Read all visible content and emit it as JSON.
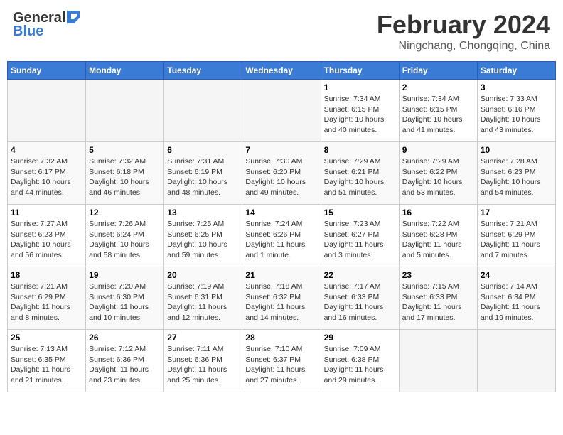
{
  "header": {
    "logo_general": "General",
    "logo_blue": "Blue",
    "title": "February 2024",
    "subtitle": "Ningchang, Chongqing, China"
  },
  "days_of_week": [
    "Sunday",
    "Monday",
    "Tuesday",
    "Wednesday",
    "Thursday",
    "Friday",
    "Saturday"
  ],
  "weeks": [
    [
      {
        "day": "",
        "info": ""
      },
      {
        "day": "",
        "info": ""
      },
      {
        "day": "",
        "info": ""
      },
      {
        "day": "",
        "info": ""
      },
      {
        "day": "1",
        "info": "Sunrise: 7:34 AM\nSunset: 6:15 PM\nDaylight: 10 hours\nand 40 minutes."
      },
      {
        "day": "2",
        "info": "Sunrise: 7:34 AM\nSunset: 6:15 PM\nDaylight: 10 hours\nand 41 minutes."
      },
      {
        "day": "3",
        "info": "Sunrise: 7:33 AM\nSunset: 6:16 PM\nDaylight: 10 hours\nand 43 minutes."
      }
    ],
    [
      {
        "day": "4",
        "info": "Sunrise: 7:32 AM\nSunset: 6:17 PM\nDaylight: 10 hours\nand 44 minutes."
      },
      {
        "day": "5",
        "info": "Sunrise: 7:32 AM\nSunset: 6:18 PM\nDaylight: 10 hours\nand 46 minutes."
      },
      {
        "day": "6",
        "info": "Sunrise: 7:31 AM\nSunset: 6:19 PM\nDaylight: 10 hours\nand 48 minutes."
      },
      {
        "day": "7",
        "info": "Sunrise: 7:30 AM\nSunset: 6:20 PM\nDaylight: 10 hours\nand 49 minutes."
      },
      {
        "day": "8",
        "info": "Sunrise: 7:29 AM\nSunset: 6:21 PM\nDaylight: 10 hours\nand 51 minutes."
      },
      {
        "day": "9",
        "info": "Sunrise: 7:29 AM\nSunset: 6:22 PM\nDaylight: 10 hours\nand 53 minutes."
      },
      {
        "day": "10",
        "info": "Sunrise: 7:28 AM\nSunset: 6:23 PM\nDaylight: 10 hours\nand 54 minutes."
      }
    ],
    [
      {
        "day": "11",
        "info": "Sunrise: 7:27 AM\nSunset: 6:23 PM\nDaylight: 10 hours\nand 56 minutes."
      },
      {
        "day": "12",
        "info": "Sunrise: 7:26 AM\nSunset: 6:24 PM\nDaylight: 10 hours\nand 58 minutes."
      },
      {
        "day": "13",
        "info": "Sunrise: 7:25 AM\nSunset: 6:25 PM\nDaylight: 10 hours\nand 59 minutes."
      },
      {
        "day": "14",
        "info": "Sunrise: 7:24 AM\nSunset: 6:26 PM\nDaylight: 11 hours\nand 1 minute."
      },
      {
        "day": "15",
        "info": "Sunrise: 7:23 AM\nSunset: 6:27 PM\nDaylight: 11 hours\nand 3 minutes."
      },
      {
        "day": "16",
        "info": "Sunrise: 7:22 AM\nSunset: 6:28 PM\nDaylight: 11 hours\nand 5 minutes."
      },
      {
        "day": "17",
        "info": "Sunrise: 7:21 AM\nSunset: 6:29 PM\nDaylight: 11 hours\nand 7 minutes."
      }
    ],
    [
      {
        "day": "18",
        "info": "Sunrise: 7:21 AM\nSunset: 6:29 PM\nDaylight: 11 hours\nand 8 minutes."
      },
      {
        "day": "19",
        "info": "Sunrise: 7:20 AM\nSunset: 6:30 PM\nDaylight: 11 hours\nand 10 minutes."
      },
      {
        "day": "20",
        "info": "Sunrise: 7:19 AM\nSunset: 6:31 PM\nDaylight: 11 hours\nand 12 minutes."
      },
      {
        "day": "21",
        "info": "Sunrise: 7:18 AM\nSunset: 6:32 PM\nDaylight: 11 hours\nand 14 minutes."
      },
      {
        "day": "22",
        "info": "Sunrise: 7:17 AM\nSunset: 6:33 PM\nDaylight: 11 hours\nand 16 minutes."
      },
      {
        "day": "23",
        "info": "Sunrise: 7:15 AM\nSunset: 6:33 PM\nDaylight: 11 hours\nand 17 minutes."
      },
      {
        "day": "24",
        "info": "Sunrise: 7:14 AM\nSunset: 6:34 PM\nDaylight: 11 hours\nand 19 minutes."
      }
    ],
    [
      {
        "day": "25",
        "info": "Sunrise: 7:13 AM\nSunset: 6:35 PM\nDaylight: 11 hours\nand 21 minutes."
      },
      {
        "day": "26",
        "info": "Sunrise: 7:12 AM\nSunset: 6:36 PM\nDaylight: 11 hours\nand 23 minutes."
      },
      {
        "day": "27",
        "info": "Sunrise: 7:11 AM\nSunset: 6:36 PM\nDaylight: 11 hours\nand 25 minutes."
      },
      {
        "day": "28",
        "info": "Sunrise: 7:10 AM\nSunset: 6:37 PM\nDaylight: 11 hours\nand 27 minutes."
      },
      {
        "day": "29",
        "info": "Sunrise: 7:09 AM\nSunset: 6:38 PM\nDaylight: 11 hours\nand 29 minutes."
      },
      {
        "day": "",
        "info": ""
      },
      {
        "day": "",
        "info": ""
      }
    ]
  ]
}
